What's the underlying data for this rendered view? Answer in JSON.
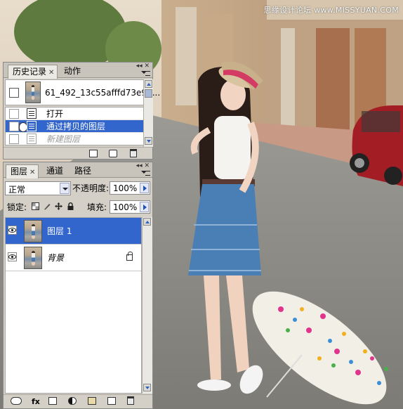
{
  "watermark": "思缘设计论坛 www.MISSYUAN.COM",
  "colors": {
    "panel_bg": "#d4d0c8",
    "selection": "#3366cc",
    "scroll_arrow": "#3060c0"
  },
  "history_panel": {
    "tabs": [
      {
        "label": "历史记录",
        "active": true,
        "closable": true
      },
      {
        "label": "动作",
        "active": false,
        "closable": false
      }
    ],
    "snapshot_name": "61_492_13c55afffd73e96...",
    "steps": [
      {
        "label": "打开",
        "state": "normal",
        "icon": "step-icon"
      },
      {
        "label": "通过拷贝的图层",
        "state": "selected",
        "icon": "step-icon"
      },
      {
        "label": "新建图层",
        "state": "dimmed",
        "icon": "step-icon"
      }
    ],
    "footer_icons": [
      "new-document-from-state-icon",
      "new-snapshot-icon",
      "trash-icon"
    ]
  },
  "layers_panel": {
    "tabs": [
      {
        "label": "图层",
        "active": true,
        "closable": true
      },
      {
        "label": "通道",
        "active": false,
        "closable": false
      },
      {
        "label": "路径",
        "active": false,
        "closable": false
      }
    ],
    "blend_mode": "正常",
    "opacity_label": "不透明度:",
    "opacity_value": "100%",
    "lock_label": "锁定:",
    "fill_label": "填充:",
    "fill_value": "100%",
    "lock_icons": [
      "lock-transparent-icon",
      "lock-paint-icon",
      "lock-move-icon",
      "lock-all-icon"
    ],
    "layers": [
      {
        "name": "图层 1",
        "selected": true,
        "visible": true,
        "locked": false
      },
      {
        "name": "背景",
        "selected": false,
        "visible": true,
        "locked": true
      }
    ],
    "footer_icons": [
      "link-icon",
      "fx-icon",
      "mask-icon",
      "adjustment-icon",
      "group-icon",
      "new-layer-icon",
      "trash-icon"
    ]
  }
}
